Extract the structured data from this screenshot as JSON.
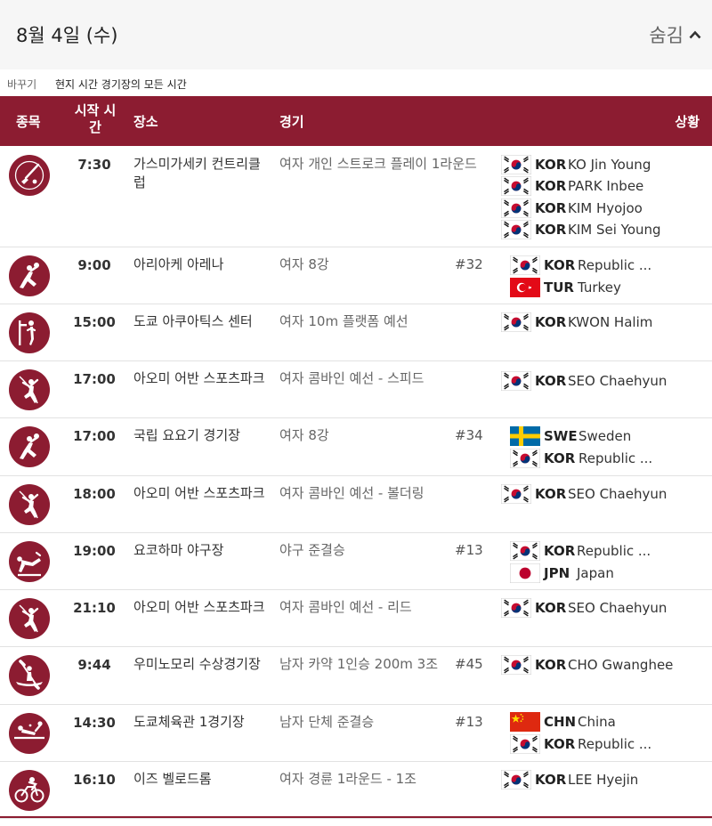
{
  "header": {
    "date": "8월 4일 (수)",
    "toggle_label": "숨김"
  },
  "timezone": {
    "switch_label": "바꾸기",
    "current_label": "현지 시간 경기장의 모든 시간"
  },
  "columns": {
    "sport": "종목",
    "time": "시작 시간",
    "venue": "장소",
    "event": "경기",
    "status": "상황"
  },
  "colors": {
    "brand": "#8c1c31"
  },
  "rows": [
    {
      "sport_icon": "golf-icon",
      "time": "7:30",
      "venue": "가스미가세키 컨트리클럽",
      "event": "여자 개인 스트로크 플레이 1라운드",
      "match": "",
      "participants": [
        {
          "flag": "kor",
          "noc": "KOR",
          "name": "KO Jin Young"
        },
        {
          "flag": "kor",
          "noc": "KOR",
          "name": "PARK Inbee"
        },
        {
          "flag": "kor",
          "noc": "KOR",
          "name": "KIM Hyojoo"
        },
        {
          "flag": "kor",
          "noc": "KOR",
          "name": "KIM Sei Young"
        }
      ]
    },
    {
      "sport_icon": "handball-icon",
      "time": "9:00",
      "venue": "아리아케 아레나",
      "event": "여자 8강",
      "match": "#32",
      "participants": [
        {
          "flag": "kor",
          "noc": "KOR",
          "name": "Republic ..."
        },
        {
          "flag": "tur",
          "noc": "TUR",
          "name": "Turkey"
        }
      ]
    },
    {
      "sport_icon": "diving-icon",
      "time": "15:00",
      "venue": "도쿄 아쿠아틱스 센터",
      "event": "여자 10m 플랫폼 예선",
      "match": "",
      "participants": [
        {
          "flag": "kor",
          "noc": "KOR",
          "name": "KWON Halim"
        }
      ]
    },
    {
      "sport_icon": "climbing-icon",
      "time": "17:00",
      "venue": "아오미 어반 스포츠파크",
      "event": "여자 콤바인 예선 - 스피드",
      "match": "",
      "participants": [
        {
          "flag": "kor",
          "noc": "KOR",
          "name": "SEO Chaehyun"
        }
      ]
    },
    {
      "sport_icon": "handball-icon",
      "time": "17:00",
      "venue": "국립 요요기 경기장",
      "event": "여자 8강",
      "match": "#34",
      "participants": [
        {
          "flag": "swe",
          "noc": "SWE",
          "name": "Sweden"
        },
        {
          "flag": "kor",
          "noc": "KOR",
          "name": "Republic ..."
        }
      ]
    },
    {
      "sport_icon": "climbing-icon",
      "time": "18:00",
      "venue": "아오미 어반 스포츠파크",
      "event": "여자 콤바인 예선 - 볼더링",
      "match": "",
      "participants": [
        {
          "flag": "kor",
          "noc": "KOR",
          "name": "SEO Chaehyun"
        }
      ]
    },
    {
      "sport_icon": "baseball-icon",
      "time": "19:00",
      "venue": "요코하마 야구장",
      "event": "야구 준결승",
      "match": "#13",
      "participants": [
        {
          "flag": "kor",
          "noc": "KOR",
          "name": "Republic ..."
        },
        {
          "flag": "jpn",
          "noc": "JPN",
          "name": "Japan"
        }
      ]
    },
    {
      "sport_icon": "climbing-icon",
      "time": "21:10",
      "venue": "아오미 어반 스포츠파크",
      "event": "여자 콤바인 예선 - 리드",
      "match": "",
      "participants": [
        {
          "flag": "kor",
          "noc": "KOR",
          "name": "SEO Chaehyun"
        }
      ]
    },
    {
      "sport_icon": "canoe-icon",
      "time": "9:44",
      "venue": "우미노모리 수상경기장",
      "event": "남자 카약 1인승 200m 3조",
      "match": "#45",
      "participants": [
        {
          "flag": "kor",
          "noc": "KOR",
          "name": "CHO Gwanghee"
        }
      ]
    },
    {
      "sport_icon": "table-tennis-icon",
      "time": "14:30",
      "venue": "도쿄체육관 1경기장",
      "event": "남자 단체 준결승",
      "match": "#13",
      "participants": [
        {
          "flag": "chn",
          "noc": "CHN",
          "name": "China"
        },
        {
          "flag": "kor",
          "noc": "KOR",
          "name": "Republic ..."
        }
      ]
    },
    {
      "sport_icon": "cycling-icon",
      "time": "16:10",
      "venue": "이즈 벨로드롬",
      "event": "여자 경륜 1라운드 - 1조",
      "match": "",
      "participants": [
        {
          "flag": "kor",
          "noc": "KOR",
          "name": "LEE Hyejin"
        }
      ]
    }
  ]
}
